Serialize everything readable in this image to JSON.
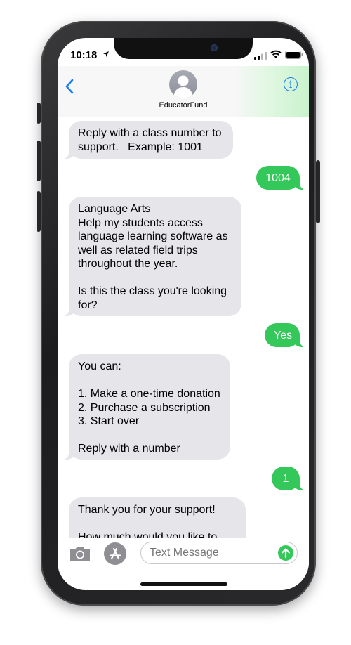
{
  "status_bar": {
    "time": "10:18"
  },
  "header": {
    "contact_name": "EducatorFund",
    "info_label": "i"
  },
  "messages": [
    {
      "direction": "incoming",
      "text": "Reply with a class number to support.   Example: 1001"
    },
    {
      "direction": "outgoing",
      "text": "1004"
    },
    {
      "direction": "incoming",
      "text": "Language Arts\nHelp my students access language learning software as well as related field trips throughout the year.\n\nIs this the class you're looking for?"
    },
    {
      "direction": "outgoing",
      "text": "Yes"
    },
    {
      "direction": "incoming",
      "text": "You can:\n\n1. Make a one-time donation\n2. Purchase a subscription\n3. Start over\n\nReply with a number"
    },
    {
      "direction": "outgoing",
      "text": "1"
    },
    {
      "direction": "incoming",
      "text": "Thank you for your support!\n\nHow much would you like to"
    }
  ],
  "composer": {
    "placeholder": "Text Message"
  },
  "colors": {
    "outgoing_bubble": "#34c759",
    "incoming_bubble": "#e5e5ea",
    "accent": "#1a7cf5"
  },
  "icons": [
    "location-arrow-icon",
    "cellular-signal-icon",
    "wifi-icon",
    "battery-icon",
    "chevron-left-icon",
    "person-icon",
    "info-icon",
    "camera-icon",
    "app-store-icon",
    "arrow-up-icon"
  ]
}
